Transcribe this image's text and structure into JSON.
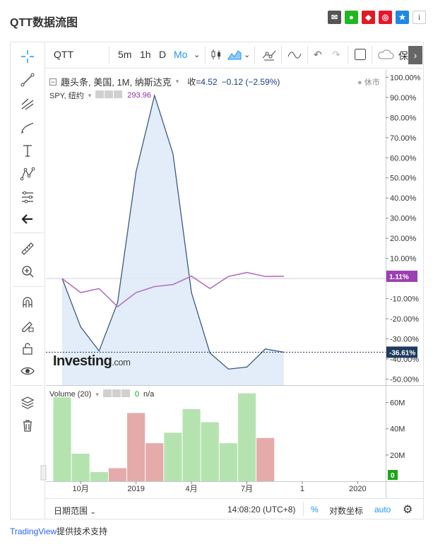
{
  "page_title": "QTT数据流图",
  "share_icons": [
    {
      "name": "email-icon",
      "color": "#555555",
      "glyph": "✉"
    },
    {
      "name": "wechat-icon",
      "color": "#22b722",
      "glyph": "◉"
    },
    {
      "name": "qq-icon",
      "color": "#e01b24",
      "glyph": "◆"
    },
    {
      "name": "weibo-icon",
      "color": "#e6162d",
      "glyph": "◎"
    },
    {
      "name": "star-icon",
      "color": "#1e88e5",
      "glyph": "★"
    }
  ],
  "info_label": "i",
  "toolbar": {
    "symbol": "QTT",
    "intervals": [
      "5m",
      "1h",
      "D",
      "Mo"
    ],
    "active_interval": "Mo",
    "save_label": "保存"
  },
  "legend": {
    "main": "趣头条, 美国, 1M, 纳斯达克",
    "close_label": "收=",
    "close_value": "4.52",
    "change": "−0.12 (−2.59%)",
    "compare_name": "SPY, 纽约",
    "compare_value": "293.96",
    "status": "休市"
  },
  "volume_legend": {
    "name": "Volume (20)",
    "value": "0",
    "na": "n/a"
  },
  "watermark": {
    "brand": "Investing",
    "suffix": ".com"
  },
  "bottom": {
    "range_label": "日期范围",
    "time": "14:08:20 (UTC+8)",
    "percent": "%",
    "log": "对数坐标",
    "auto": "auto"
  },
  "footer": {
    "brand": "TradingView",
    "text": "提供技术支持"
  },
  "colors": {
    "qtt_line": "#3b5b7d",
    "qtt_fill": "#dbe9f8",
    "spy_line": "#b26fc1",
    "vol_up": "#b5e3b0",
    "vol_down": "#e5aaaa"
  },
  "chart_data": {
    "type": "line",
    "x": [
      "2018-09",
      "2018-10",
      "2018-11",
      "2018-12",
      "2019-01",
      "2019-02",
      "2019-03",
      "2019-04",
      "2019-05",
      "2019-06",
      "2019-07",
      "2019-08",
      "2019-09"
    ],
    "xtick_labels": [
      {
        "x": "2018-10",
        "label": "10月"
      },
      {
        "x": "2019-01",
        "label": "2019"
      },
      {
        "x": "2019-04",
        "label": "4月"
      },
      {
        "x": "2019-07",
        "label": "7月"
      },
      {
        "x": "2019-10",
        "label": "1"
      },
      {
        "x": "2020-01",
        "label": "2020"
      }
    ],
    "yticks": [
      100,
      90,
      80,
      70,
      60,
      50,
      40,
      30,
      20,
      10,
      0,
      -10,
      -20,
      -30,
      -40,
      -50
    ],
    "ytick_labels": [
      "100.00%",
      "90.00%",
      "80.00%",
      "70.00%",
      "60.00%",
      "50.00%",
      "40.00%",
      "30.00%",
      "20.00%",
      "10.00%",
      "",
      "-10.00%",
      "-20.00%",
      "-30.00%",
      "-40.00%",
      "-50.00%"
    ],
    "ylim": [
      -53,
      104
    ],
    "series": [
      {
        "name": "QTT",
        "values": [
          0,
          -24,
          -36,
          -12,
          53,
          91,
          62,
          -7,
          -37,
          -45,
          -44,
          -35,
          -36.61
        ]
      },
      {
        "name": "SPY",
        "values": [
          0,
          -7,
          -5,
          -14,
          -7,
          -4,
          -3,
          1.2,
          -5,
          1,
          3,
          1,
          1.11
        ]
      }
    ],
    "last_labels": [
      {
        "series": "SPY",
        "value": 1.11,
        "label": "1.11%",
        "color": "#9c3fb0"
      },
      {
        "series": "QTT",
        "value": -36.61,
        "label": "-36.61%",
        "color": "#1e3a5f"
      }
    ],
    "volume": {
      "ylim": [
        0,
        70
      ],
      "ytick_labels": [
        "60M",
        "40M",
        "20M"
      ],
      "yticks": [
        60,
        40,
        20
      ],
      "values": [
        64,
        21,
        7,
        10,
        52,
        29,
        37,
        55,
        45,
        29,
        67,
        33
      ],
      "up": [
        true,
        true,
        true,
        false,
        false,
        false,
        true,
        true,
        true,
        true,
        true,
        false
      ],
      "zero_label": "0"
    }
  }
}
